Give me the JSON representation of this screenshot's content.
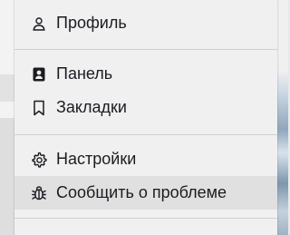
{
  "menu": {
    "items": [
      {
        "label": "Профиль",
        "icon": "user-icon"
      },
      {
        "label": "Панель",
        "icon": "contact-card-icon"
      },
      {
        "label": "Закладки",
        "icon": "bookmark-icon"
      },
      {
        "label": "Настройки",
        "icon": "gear-icon"
      },
      {
        "label": "Сообщить о проблеме",
        "icon": "bug-icon",
        "highlighted": true
      }
    ]
  },
  "colors": {
    "menu_bg": "#f0f0f0",
    "hover_bg": "#e0e0e0",
    "separator": "#cfcfd8",
    "text": "#1c1b22"
  }
}
